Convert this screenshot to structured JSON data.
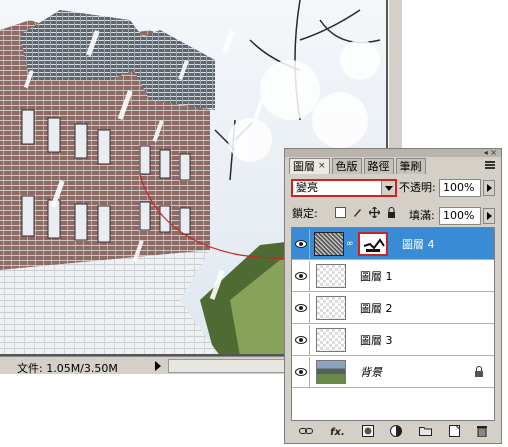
{
  "status_bar": {
    "doc_size": "文件: 1.05M/3.50M"
  },
  "layers_panel": {
    "tabs": [
      {
        "label": "圖層",
        "active": true
      },
      {
        "label": "色版",
        "active": false
      },
      {
        "label": "路徑",
        "active": false
      },
      {
        "label": "筆刷",
        "active": false
      }
    ],
    "blend_mode": "變亮",
    "opacity_label": "不透明:",
    "opacity_value": "100%",
    "lock_label": "鎖定:",
    "fill_label": "填滿:",
    "fill_value": "100%",
    "layers": [
      {
        "name": "圖層 4",
        "selected": true,
        "visible": true,
        "thumb": "noise",
        "has_mask": true
      },
      {
        "name": "圖層 1",
        "selected": false,
        "visible": true,
        "thumb": "transparent"
      },
      {
        "name": "圖層 2",
        "selected": false,
        "visible": true,
        "thumb": "transparent"
      },
      {
        "name": "圖層 3",
        "selected": false,
        "visible": true,
        "thumb": "transparent"
      },
      {
        "name": "背景",
        "selected": false,
        "visible": true,
        "thumb": "photo",
        "locked": true
      }
    ],
    "bottom_buttons": [
      "link-icon",
      "fx-icon",
      "mask-icon",
      "adjustment-icon",
      "group-icon",
      "new-layer-icon",
      "trash-icon"
    ],
    "fx_label": "fx."
  },
  "colors": {
    "selection": "#3a8bd6",
    "highlight_red": "#cc2222"
  }
}
